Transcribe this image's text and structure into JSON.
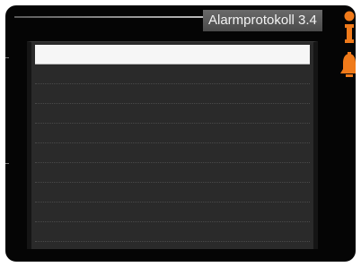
{
  "header": {
    "title": "Alarmprotokoll 3.4"
  },
  "icons": {
    "info": "info-icon",
    "alarm": "alarm-bell-icon"
  },
  "colors": {
    "accent": "#f07a1a",
    "background": "#050505",
    "panel": "#2a2a2a",
    "selection": "#f6f6f6"
  },
  "log": {
    "rows": [
      "",
      "",
      "",
      "",
      "",
      "",
      "",
      "",
      "",
      ""
    ],
    "selected_index": 0
  }
}
